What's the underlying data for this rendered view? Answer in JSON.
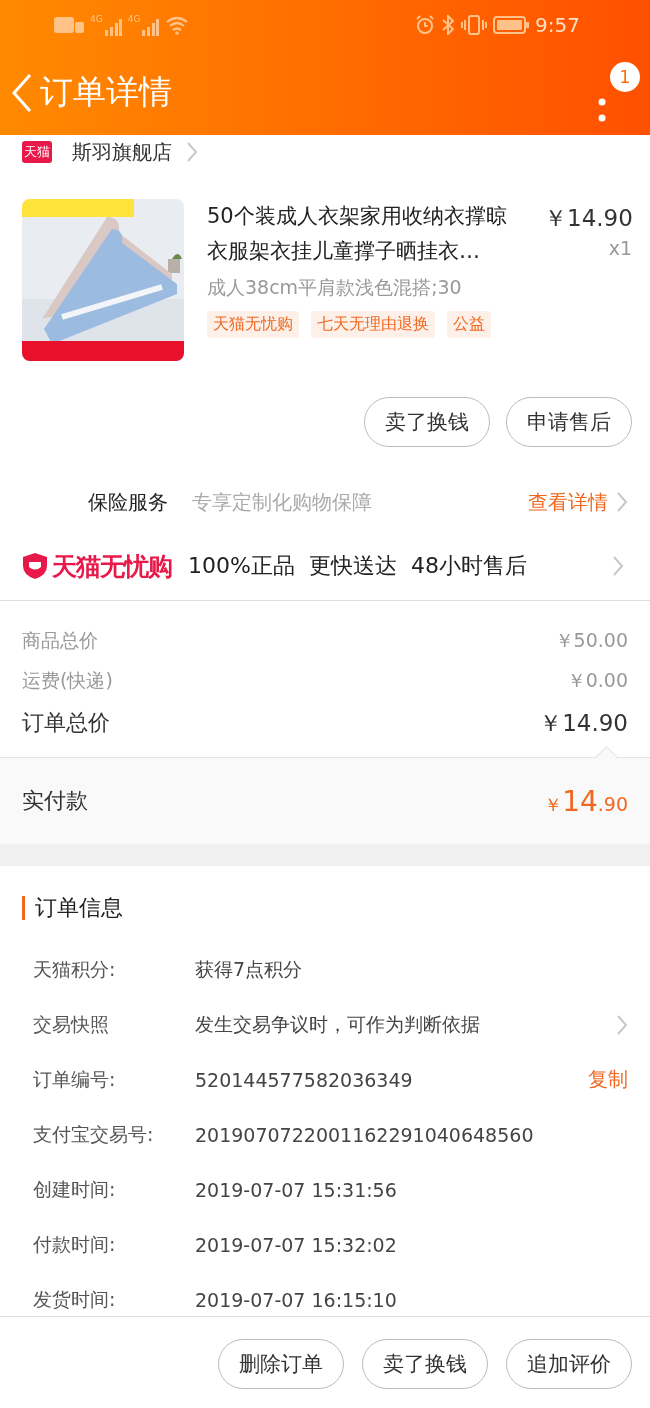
{
  "status_bar": {
    "time": "9:57",
    "networks": [
      "4G",
      "4G"
    ]
  },
  "header": {
    "title": "订单详情",
    "badge": "1"
  },
  "shop": {
    "logo": "天猫",
    "name": "斯羽旗舰店"
  },
  "product": {
    "title": "50个装成人衣架家用收纳衣撑晾衣服架衣挂儿童撑子晒挂衣…",
    "price": "￥14.90",
    "quantity": "x1",
    "sku": "成人38cm平肩款浅色混搭;30",
    "tags": [
      "天猫无忧购",
      "七天无理由退换",
      "公益"
    ]
  },
  "item_actions": [
    "卖了换钱",
    "申请售后"
  ],
  "insurance": {
    "label": "保险服务",
    "description": "专享定制化购物保障",
    "link": "查看详情"
  },
  "guarantee": {
    "brand": "天猫无忧购",
    "features": [
      "100%正品",
      "更快送达",
      "48小时售后"
    ]
  },
  "price_summary": [
    {
      "label": "商品总价",
      "value": "￥50.00",
      "kind": "minor"
    },
    {
      "label": "运费(快递)",
      "value": "￥0.00",
      "kind": "minor"
    },
    {
      "label": "订单总价",
      "value": "￥14.90",
      "kind": "major"
    }
  ],
  "paid": {
    "label": "实付款",
    "currency": "￥",
    "integer": "14",
    "decimal": ".90"
  },
  "order_info": {
    "title": "订单信息",
    "rows": [
      {
        "label": "天猫积分:",
        "value": "获得7点积分",
        "kind": "plain"
      },
      {
        "label": "交易快照",
        "value": "发生交易争议时，可作为判断依据",
        "kind": "link"
      },
      {
        "label": "订单编号:",
        "value": "520144577582036349",
        "kind": "copy",
        "action": "复制"
      },
      {
        "label": "支付宝交易号:",
        "value": "2019070722001162291040648560",
        "kind": "plain"
      },
      {
        "label": "创建时间:",
        "value": "2019-07-07 15:31:56",
        "kind": "plain"
      },
      {
        "label": "付款时间:",
        "value": "2019-07-07 15:32:02",
        "kind": "plain"
      },
      {
        "label": "发货时间:",
        "value": "2019-07-07 16:15:10",
        "kind": "plain"
      }
    ]
  },
  "bottom_actions": [
    "删除订单",
    "卖了换钱",
    "追加评价"
  ]
}
